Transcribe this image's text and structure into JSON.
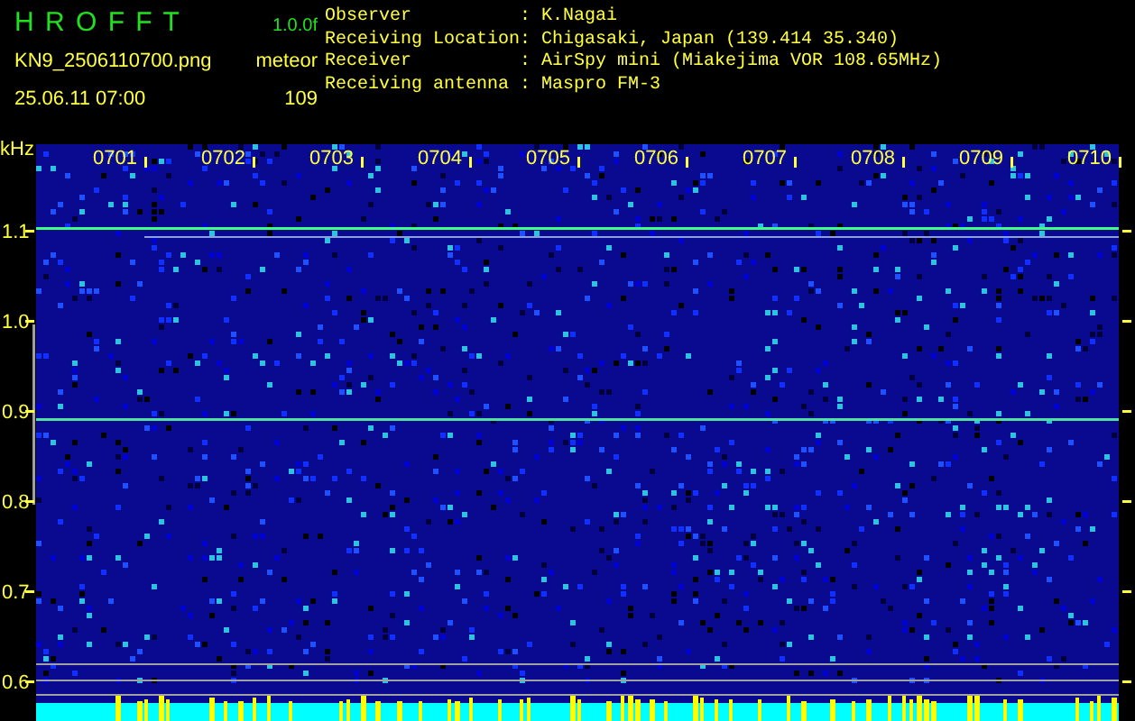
{
  "header": {
    "logo": "H R O F F T",
    "version": "1.0.0f",
    "filename": "KN9_2506110700.png",
    "timestamp": "25.06.11 07:00",
    "count_label": "meteor",
    "count": "109"
  },
  "info": [
    {
      "label": "Observer",
      "separator": ":",
      "value": "K.Nagai"
    },
    {
      "label": "Receiving Location",
      "separator": ":",
      "value": "Chigasaki, Japan (139.414 35.340)"
    },
    {
      "label": "Receiver",
      "separator": ":",
      "value": "AirSpy mini (Miakejima VOR 108.65MHz)"
    },
    {
      "label": "Receiving antenna",
      "separator": ":",
      "value": "Maspro FM-3"
    }
  ],
  "spectrogram": {
    "unit": "kHz",
    "time_labels": [
      "0701",
      "0702",
      "0703",
      "0704",
      "0705",
      "0706",
      "0707",
      "0708",
      "0709",
      "0710"
    ],
    "frequency_labels": [
      "1.1",
      "1.0",
      "0.9",
      "0.8",
      "0.7",
      "0.6"
    ]
  }
}
